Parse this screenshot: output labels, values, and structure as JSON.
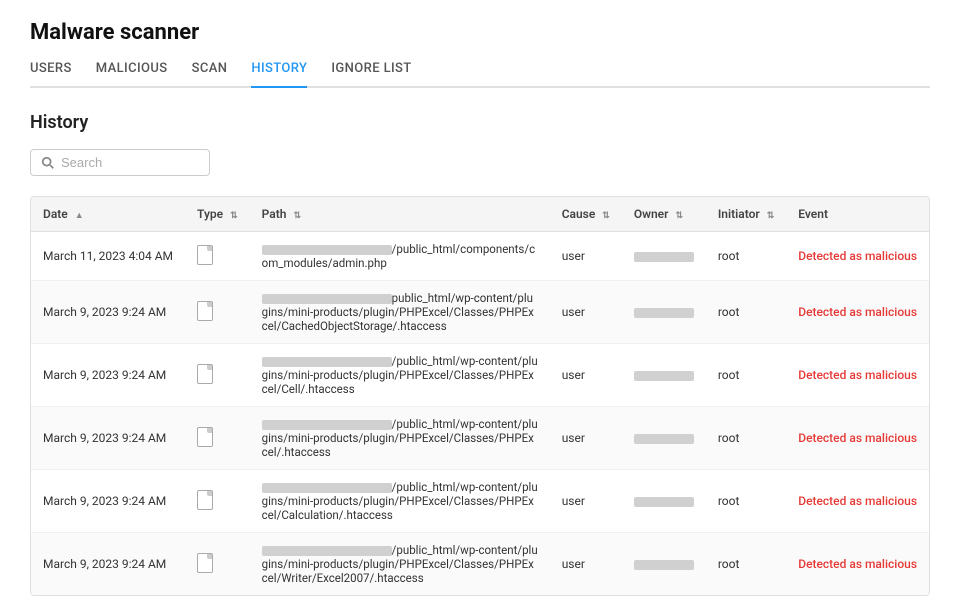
{
  "appTitle": "Malware scanner",
  "tabs": [
    {
      "label": "USERS",
      "active": false
    },
    {
      "label": "MALICIOUS",
      "active": false
    },
    {
      "label": "SCAN",
      "active": false
    },
    {
      "label": "HISTORY",
      "active": true
    },
    {
      "label": "IGNORE LIST",
      "active": false
    }
  ],
  "sectionTitle": "History",
  "search": {
    "placeholder": "Search",
    "value": ""
  },
  "table": {
    "columns": [
      {
        "label": "Date",
        "sortable": true
      },
      {
        "label": "Type",
        "sortable": true
      },
      {
        "label": "Path",
        "sortable": true
      },
      {
        "label": "Cause",
        "sortable": true
      },
      {
        "label": "Owner",
        "sortable": true
      },
      {
        "label": "Initiator",
        "sortable": true
      },
      {
        "label": "Event",
        "sortable": false
      }
    ],
    "rows": [
      {
        "date": "March 11, 2023 4:04 AM",
        "type": "file",
        "pathBlurWidth1": 130,
        "pathSuffix": "/public_html/components/com_modules/admin.php",
        "cause": "user",
        "ownerBlur": true,
        "initiator": "root",
        "event": "Detected as malicious"
      },
      {
        "date": "March 9, 2023 9:24 AM",
        "type": "file",
        "pathBlurWidth1": 130,
        "pathSuffix": "public_html/wp-content/plugins/mini-products/plugin/PHPExcel/Classes/PHPExcel/CachedObjectStorage/.htaccess",
        "cause": "user",
        "ownerBlur": true,
        "initiator": "root",
        "event": "Detected as malicious"
      },
      {
        "date": "March 9, 2023 9:24 AM",
        "type": "file",
        "pathBlurWidth1": 130,
        "pathSuffix": "/public_html/wp-content/plugins/mini-products/plugin/PHPExcel/Classes/PHPExcel/Cell/.htaccess",
        "cause": "user",
        "ownerBlur": true,
        "initiator": "root",
        "event": "Detected as malicious"
      },
      {
        "date": "March 9, 2023 9:24 AM",
        "type": "file",
        "pathBlurWidth1": 130,
        "pathSuffix": "/public_html/wp-content/plugins/mini-products/plugin/PHPExcel/Classes/PHPExcel/.htaccess",
        "cause": "user",
        "ownerBlur": true,
        "initiator": "root",
        "event": "Detected as malicious"
      },
      {
        "date": "March 9, 2023 9:24 AM",
        "type": "file",
        "pathBlurWidth1": 130,
        "pathSuffix": "/public_html/wp-content/plugins/mini-products/plugin/PHPExcel/Classes/PHPExcel/Calculation/.htaccess",
        "cause": "user",
        "ownerBlur": true,
        "initiator": "root",
        "event": "Detected as malicious"
      },
      {
        "date": "March 9, 2023 9:24 AM",
        "type": "file",
        "pathBlurWidth1": 130,
        "pathSuffix": "/public_html/wp-content/plugins/mini-products/plugin/PHPExcel/Classes/PHPExcel/Writer/Excel2007/.htaccess",
        "cause": "user",
        "ownerBlur": true,
        "initiator": "root",
        "event": "Detected as malicious"
      }
    ]
  }
}
